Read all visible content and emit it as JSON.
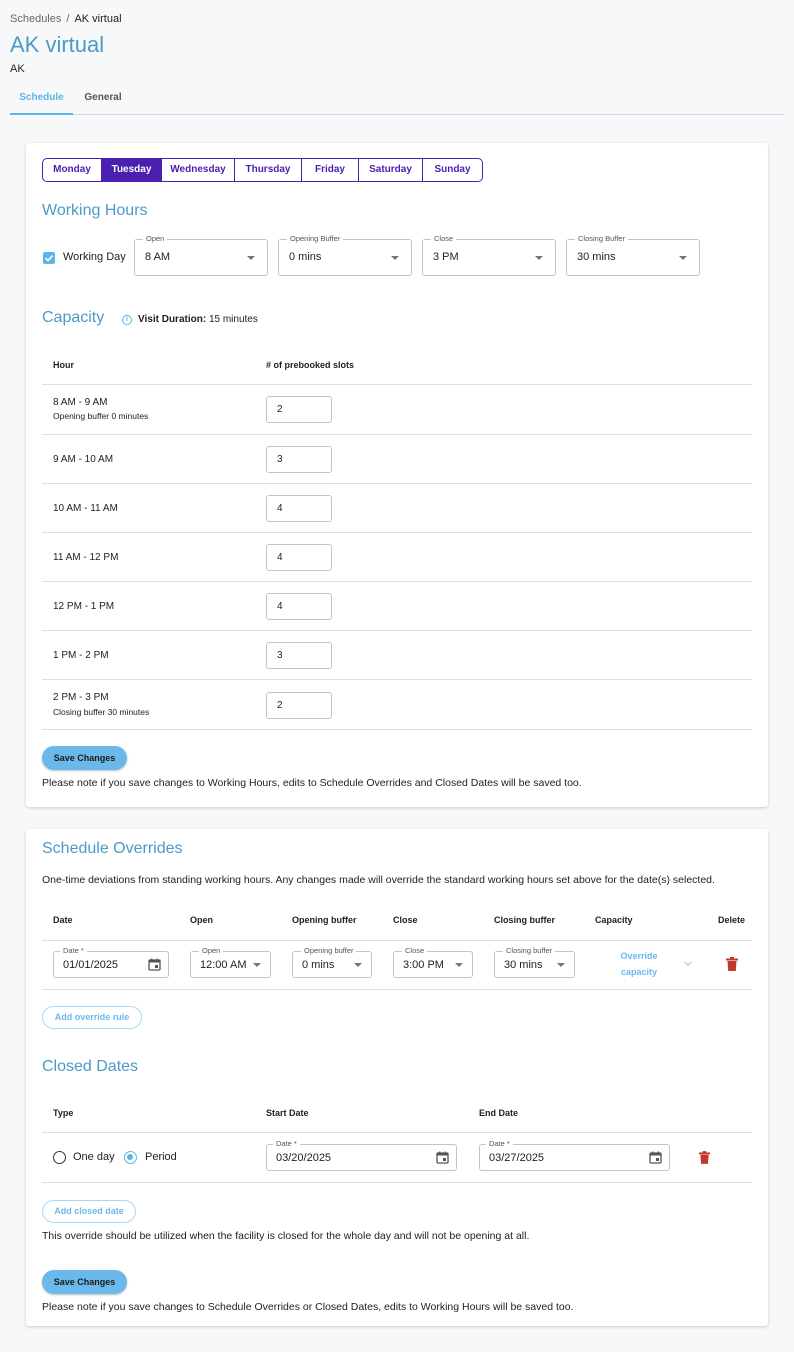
{
  "breadcrumb": {
    "parent": "Schedules",
    "separator": "/",
    "current": "AK virtual"
  },
  "header": {
    "title": "AK virtual",
    "subtitle": "AK"
  },
  "tabs": [
    {
      "label": "Schedule",
      "active": true
    },
    {
      "label": "General",
      "active": false
    }
  ],
  "days": [
    {
      "label": "Monday",
      "selected": false
    },
    {
      "label": "Tuesday",
      "selected": true
    },
    {
      "label": "Wednesday",
      "selected": false
    },
    {
      "label": "Thursday",
      "selected": false
    },
    {
      "label": "Friday",
      "selected": false
    },
    {
      "label": "Saturday",
      "selected": false
    },
    {
      "label": "Sunday",
      "selected": false
    }
  ],
  "working_hours": {
    "title": "Working Hours",
    "working_day_label": "Working Day",
    "working_day_checked": true,
    "open": {
      "label": "Open",
      "value": "8 AM"
    },
    "opening_buffer": {
      "label": "Opening Buffer",
      "value": "0 mins"
    },
    "close": {
      "label": "Close",
      "value": "3 PM"
    },
    "closing_buffer": {
      "label": "Closing Buffer",
      "value": "30 mins"
    }
  },
  "capacity": {
    "title": "Capacity",
    "info_icon": "info-icon",
    "visit_duration_label": "Visit Duration:",
    "visit_duration_value": "15 minutes",
    "columns": [
      "Hour",
      "# of prebooked slots"
    ],
    "rows": [
      {
        "hour": "8 AM - 9 AM",
        "note": "Opening buffer 0 minutes",
        "slots": "2"
      },
      {
        "hour": "9 AM - 10 AM",
        "note": "",
        "slots": "3"
      },
      {
        "hour": "10 AM - 11 AM",
        "note": "",
        "slots": "4"
      },
      {
        "hour": "11 AM - 12 PM",
        "note": "",
        "slots": "4"
      },
      {
        "hour": "12 PM - 1 PM",
        "note": "",
        "slots": "4"
      },
      {
        "hour": "1 PM - 2 PM",
        "note": "",
        "slots": "3"
      },
      {
        "hour": "2 PM - 3 PM",
        "note": "Closing buffer 30 minutes",
        "slots": "2"
      }
    ],
    "save_label": "Save Changes",
    "save_note": "Please note if you save changes to Working Hours, edits to Schedule Overrides and Closed Dates will be saved too."
  },
  "overrides": {
    "title": "Schedule Overrides",
    "description": "One-time deviations from standing working hours. Any changes made will override the standard working hours set above for the date(s) selected.",
    "columns": [
      "Date",
      "Open",
      "Opening buffer",
      "Close",
      "Closing buffer",
      "Capacity",
      "Delete"
    ],
    "rows": [
      {
        "date_label": "Date *",
        "date": "01/01/2025",
        "open_label": "Open",
        "open": "12:00 AM",
        "opening_buffer_label": "Opening buffer",
        "opening_buffer": "0 mins",
        "close_label": "Close",
        "close": "3:00 PM",
        "closing_buffer_label": "Closing buffer",
        "closing_buffer": "30 mins",
        "capacity_link": "Override capacity"
      }
    ],
    "add_label": "Add override rule"
  },
  "closed_dates": {
    "title": "Closed Dates",
    "columns": [
      "Type",
      "Start Date",
      "End Date"
    ],
    "rows": [
      {
        "type_options": [
          "One day",
          "Period"
        ],
        "selected_type": "Period",
        "start_label": "Date *",
        "start_date": "03/20/2025",
        "end_label": "Date *",
        "end_date": "03/27/2025"
      }
    ],
    "add_label": "Add closed date",
    "note": "This override should be utilized when the facility is closed for the whole day and will not be opening at all.",
    "save_label": "Save Changes",
    "save_note": "Please note if you save changes to Schedule Overrides or Closed Dates, edits to Working Hours will be saved too."
  },
  "colors": {
    "accent": "#5ab6e6",
    "title": "#4a9bc7",
    "day_selector": "#4b1fb0",
    "delete": "#c0392b"
  }
}
